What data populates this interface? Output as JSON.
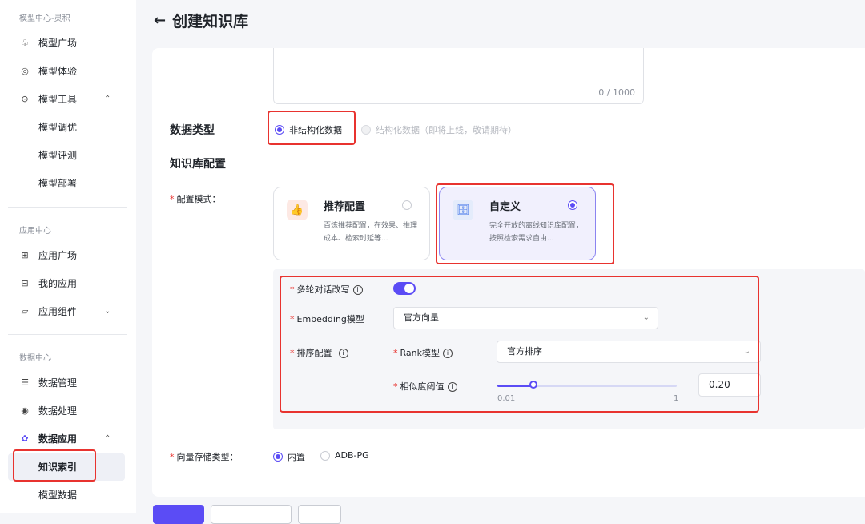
{
  "sidebar": {
    "section_model": "模型中心-灵积",
    "model_items": [
      {
        "label": "模型广场",
        "icon": "model-square-icon"
      },
      {
        "label": "模型体验",
        "icon": "model-experience-icon"
      },
      {
        "label": "模型工具",
        "icon": "model-tools-icon"
      }
    ],
    "model_tools_sub": [
      "模型调优",
      "模型评测",
      "模型部署"
    ],
    "section_app": "应用中心",
    "app_items": [
      {
        "label": "应用广场",
        "icon": "app-square-icon"
      },
      {
        "label": "我的应用",
        "icon": "my-apps-icon"
      },
      {
        "label": "应用组件",
        "icon": "app-components-icon"
      }
    ],
    "section_data": "数据中心",
    "data_items": [
      {
        "label": "数据管理",
        "icon": "data-management-icon"
      },
      {
        "label": "数据处理",
        "icon": "data-processing-icon"
      },
      {
        "label": "数据应用",
        "icon": "data-application-icon"
      }
    ],
    "data_app_sub": [
      "知识索引",
      "模型数据"
    ],
    "active_item": "知识索引",
    "chevron_up": "⌃",
    "chevron_down": "⌄"
  },
  "header": {
    "back_icon": "←",
    "title": "创建知识库"
  },
  "form": {
    "description_counter": "0 / 1000",
    "data_type": {
      "label": "数据类型",
      "options": [
        "非结构化数据",
        "结构化数据（即将上线，敬请期待）"
      ],
      "selected": "非结构化数据"
    },
    "kb_config_label": "知识库配置",
    "config_mode": {
      "label": "配置模式：",
      "cards": [
        {
          "title": "推荐配置",
          "desc": "百炼推荐配置，在效果、推理成本、检索时延等...",
          "selected": false
        },
        {
          "title": "自定义",
          "desc": "完全开放的离线知识库配置，按照检索需求自由...",
          "selected": true
        }
      ]
    },
    "multi_turn": {
      "label": "多轮对话改写",
      "enabled": true
    },
    "embedding": {
      "label": "Embedding模型",
      "value": "官方向量"
    },
    "rerank": {
      "label": "排序配置",
      "rank_model_label": "Rank模型",
      "rank_model_value": "官方排序",
      "threshold_label": "相似度阈值",
      "threshold_value": "0.20",
      "threshold_fraction": 0.2,
      "slider_min": "0.01",
      "slider_max": "1"
    },
    "vector_store": {
      "label": "向量存储类型：",
      "options": [
        "内置",
        "ADB-PG"
      ],
      "selected": "内置"
    }
  },
  "colors": {
    "accent": "#5b4cf5",
    "highlight_box": "#e8332f",
    "required": "#e8332f"
  }
}
